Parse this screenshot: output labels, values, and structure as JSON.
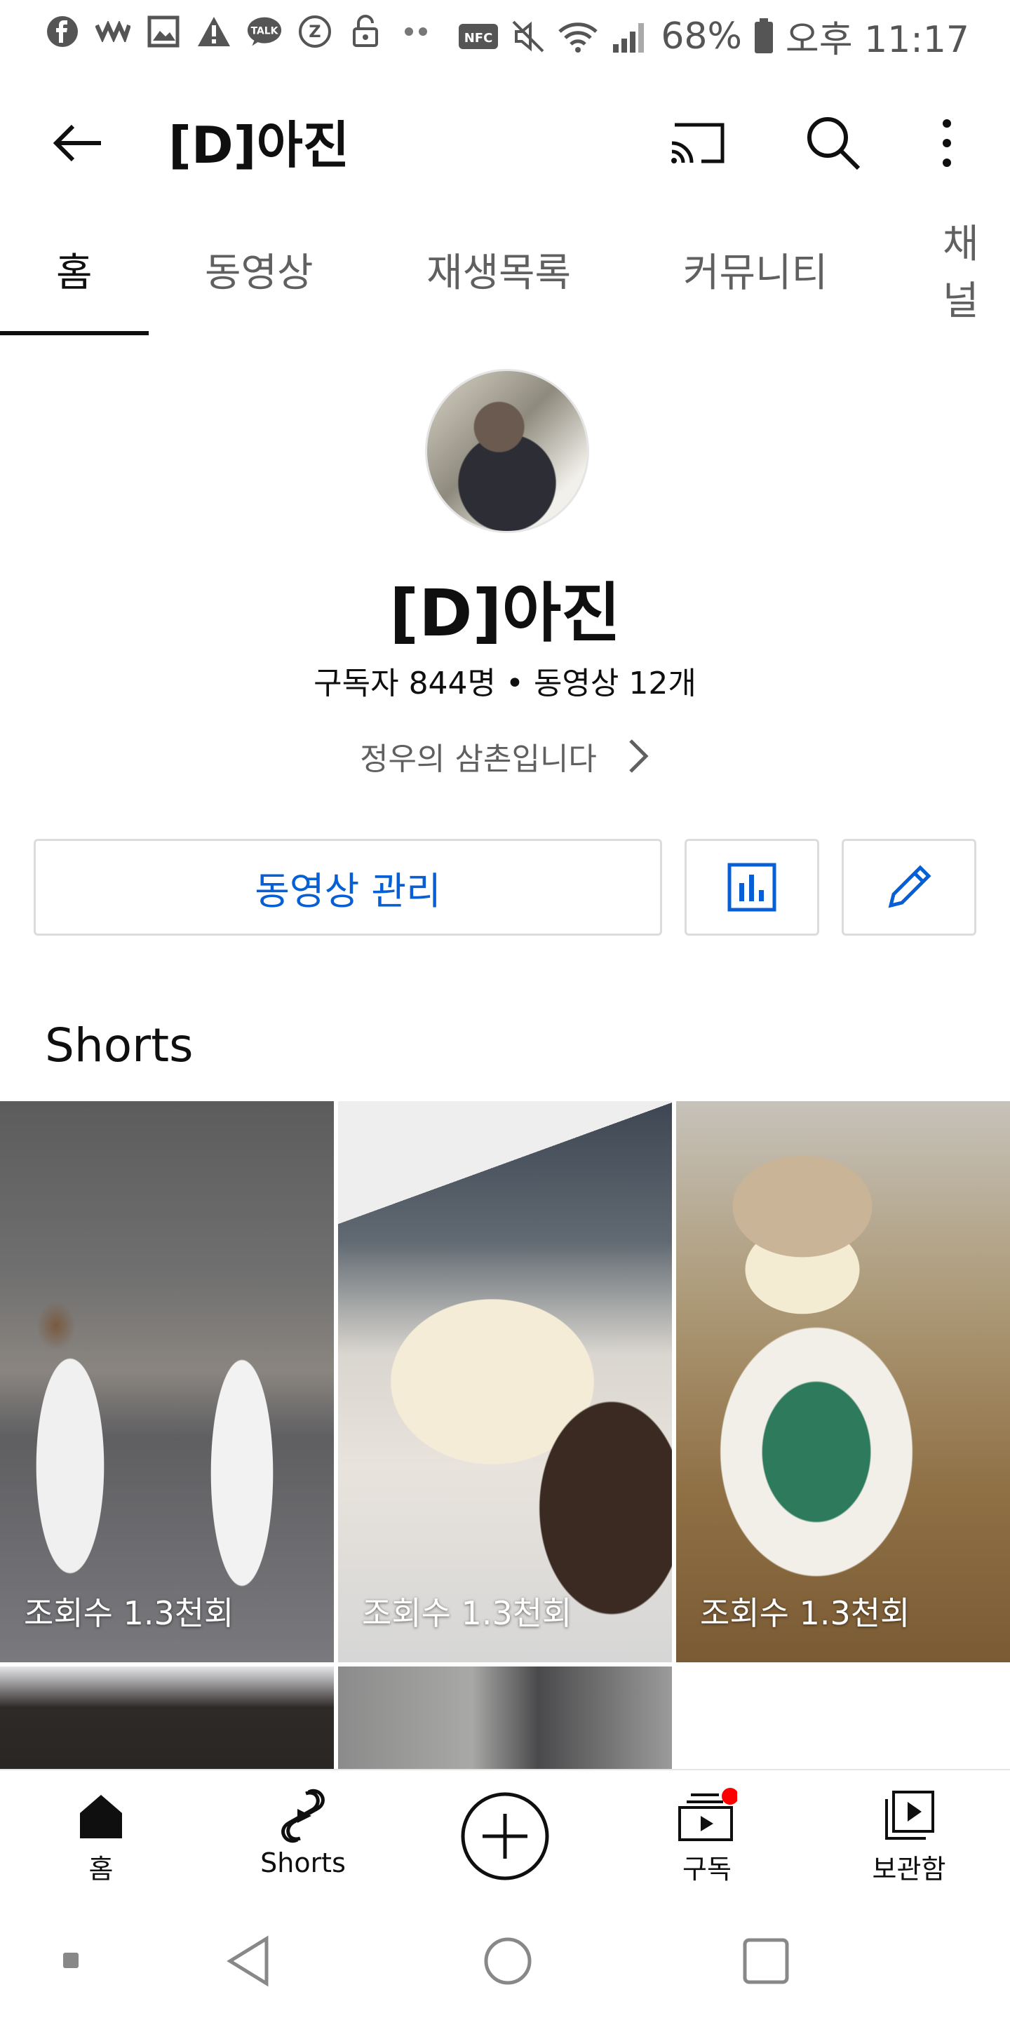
{
  "status_bar": {
    "icons": [
      "facebook-icon",
      "wavve-icon",
      "gallery-icon",
      "warning-icon",
      "talk-icon",
      "z-icon",
      "unlock-icon",
      "more-dots-icon"
    ],
    "right_icons": [
      "nfc-icon",
      "mute-icon",
      "wifi-icon",
      "signal-icon"
    ],
    "battery": "68%",
    "time": "오후 11:17"
  },
  "app_bar": {
    "title": "[D]아진"
  },
  "tabs": [
    "홈",
    "동영상",
    "재생목록",
    "커뮤니티",
    "채널"
  ],
  "channel": {
    "name": "[D]아진",
    "stats": "구독자 844명 • 동영상 12개",
    "description": "정우의 삼촌입니다"
  },
  "actions": {
    "manage_label": "동영상 관리"
  },
  "shorts": {
    "section_title": "Shorts",
    "items": [
      {
        "views": "조회수 1.3천회"
      },
      {
        "views": "조회수 1.3천회"
      },
      {
        "views": "조회수 1.3천회"
      }
    ]
  },
  "bottom_nav": {
    "home": "홈",
    "shorts": "Shorts",
    "subscriptions": "구독",
    "library": "보관함"
  },
  "colors": {
    "accent_blue": "#065fd4",
    "notification_red": "#ff0000"
  }
}
